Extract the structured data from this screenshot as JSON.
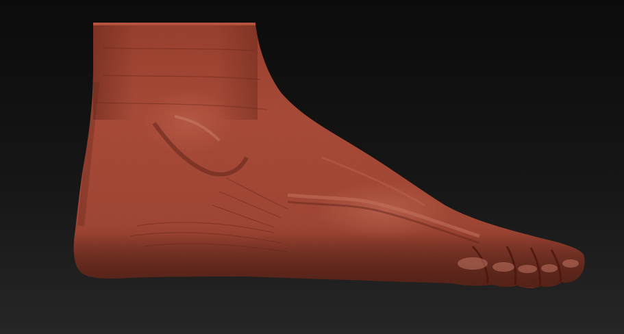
{
  "viewport": {
    "subject": "foot-sculpt",
    "background_top": "#0a0a0a",
    "background_bottom": "#242424"
  },
  "model": {
    "material_base": "#a1412e",
    "material_light": "#c45a45",
    "material_shadow": "#5e1f14",
    "material_highlight": "#d98470"
  }
}
